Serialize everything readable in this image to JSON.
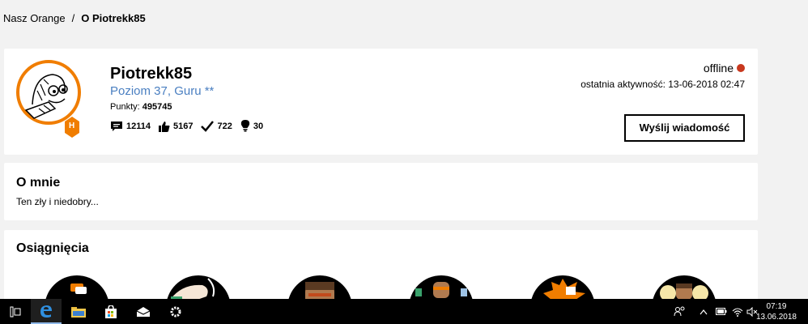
{
  "breadcrumb": {
    "home": "Nasz Orange",
    "separator": "/",
    "current": "O Piotrekk85"
  },
  "profile": {
    "username": "Piotrekk85",
    "rank": "Poziom 37, Guru **",
    "points_label": "Punkty:",
    "points_value": "495745",
    "badge_letter": "H",
    "stats": {
      "messages": "12114",
      "likes": "5167",
      "solutions": "722",
      "ideas": "30"
    },
    "status": "offline",
    "last_activity": "ostatnia aktywność: 13-06-2018 02:47",
    "send_button": "Wyślij wiadomość"
  },
  "about": {
    "title": "O mnie",
    "text": "Ten zły i niedobry..."
  },
  "achievements": {
    "title": "Osiągnięcia"
  },
  "taskbar": {
    "time": "07:19",
    "date": "13.06.2018"
  },
  "colors": {
    "accent_orange": "#f07d00",
    "link_blue": "#4a7fc1",
    "offline_red": "#c8381e"
  }
}
